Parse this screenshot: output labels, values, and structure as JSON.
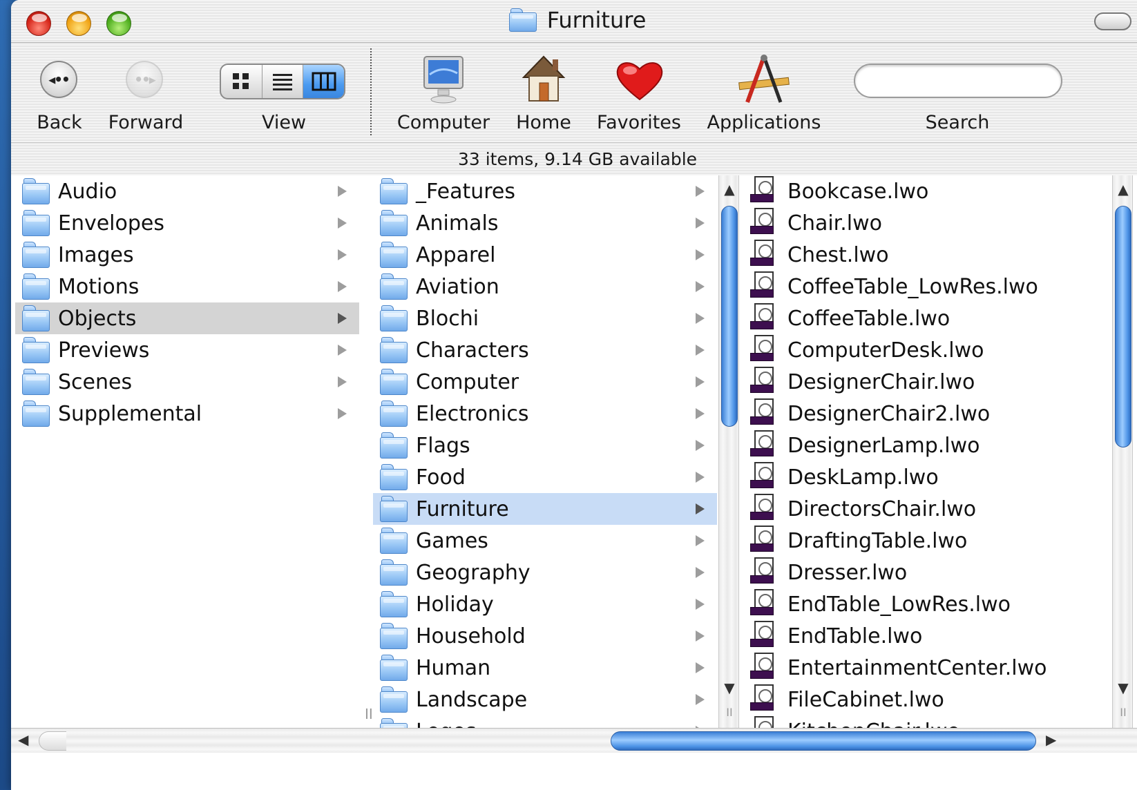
{
  "window": {
    "title": "Furniture"
  },
  "toolbar": {
    "back_label": "Back",
    "forward_label": "Forward",
    "view_label": "View",
    "computer_label": "Computer",
    "home_label": "Home",
    "favorites_label": "Favorites",
    "applications_label": "Applications",
    "search_label": "Search",
    "search_value": ""
  },
  "status": {
    "text": "33 items, 9.14 GB available"
  },
  "column1": {
    "items": [
      {
        "label": "Audio"
      },
      {
        "label": "Envelopes"
      },
      {
        "label": "Images"
      },
      {
        "label": "Motions"
      },
      {
        "label": "Objects"
      },
      {
        "label": "Previews"
      },
      {
        "label": "Scenes"
      },
      {
        "label": "Supplemental"
      }
    ],
    "selected_index": 4
  },
  "column2": {
    "items": [
      {
        "label": "_Features"
      },
      {
        "label": "Animals"
      },
      {
        "label": "Apparel"
      },
      {
        "label": "Aviation"
      },
      {
        "label": "Blochi"
      },
      {
        "label": "Characters"
      },
      {
        "label": "Computer"
      },
      {
        "label": "Electronics"
      },
      {
        "label": "Flags"
      },
      {
        "label": "Food"
      },
      {
        "label": "Furniture"
      },
      {
        "label": "Games"
      },
      {
        "label": "Geography"
      },
      {
        "label": "Holiday"
      },
      {
        "label": "Household"
      },
      {
        "label": "Human"
      },
      {
        "label": "Landscape"
      },
      {
        "label": "Logos"
      }
    ],
    "selected_index": 10
  },
  "column3": {
    "items": [
      {
        "label": "Bookcase.lwo"
      },
      {
        "label": "Chair.lwo"
      },
      {
        "label": "Chest.lwo"
      },
      {
        "label": "CoffeeTable_LowRes.lwo"
      },
      {
        "label": "CoffeeTable.lwo"
      },
      {
        "label": "ComputerDesk.lwo"
      },
      {
        "label": "DesignerChair.lwo"
      },
      {
        "label": "DesignerChair2.lwo"
      },
      {
        "label": "DesignerLamp.lwo"
      },
      {
        "label": "DeskLamp.lwo"
      },
      {
        "label": "DirectorsChair.lwo"
      },
      {
        "label": "DraftingTable.lwo"
      },
      {
        "label": "Dresser.lwo"
      },
      {
        "label": "EndTable_LowRes.lwo"
      },
      {
        "label": "EndTable.lwo"
      },
      {
        "label": "EntertainmentCenter.lwo"
      },
      {
        "label": "FileCabinet.lwo"
      },
      {
        "label": "KitchenChair.lwo"
      }
    ]
  },
  "colors": {
    "selection_blue": "#c8dcf6",
    "selection_grey": "#d4d4d4",
    "scroll_thumb": "#4d93e6"
  },
  "icons": {
    "back": "back-arrow-icon",
    "forward": "forward-arrow-icon",
    "computer": "computer-icon",
    "home": "home-icon",
    "favorites": "heart-icon",
    "applications": "applications-icon",
    "folder": "folder-icon",
    "file": "lwo-file-icon"
  }
}
